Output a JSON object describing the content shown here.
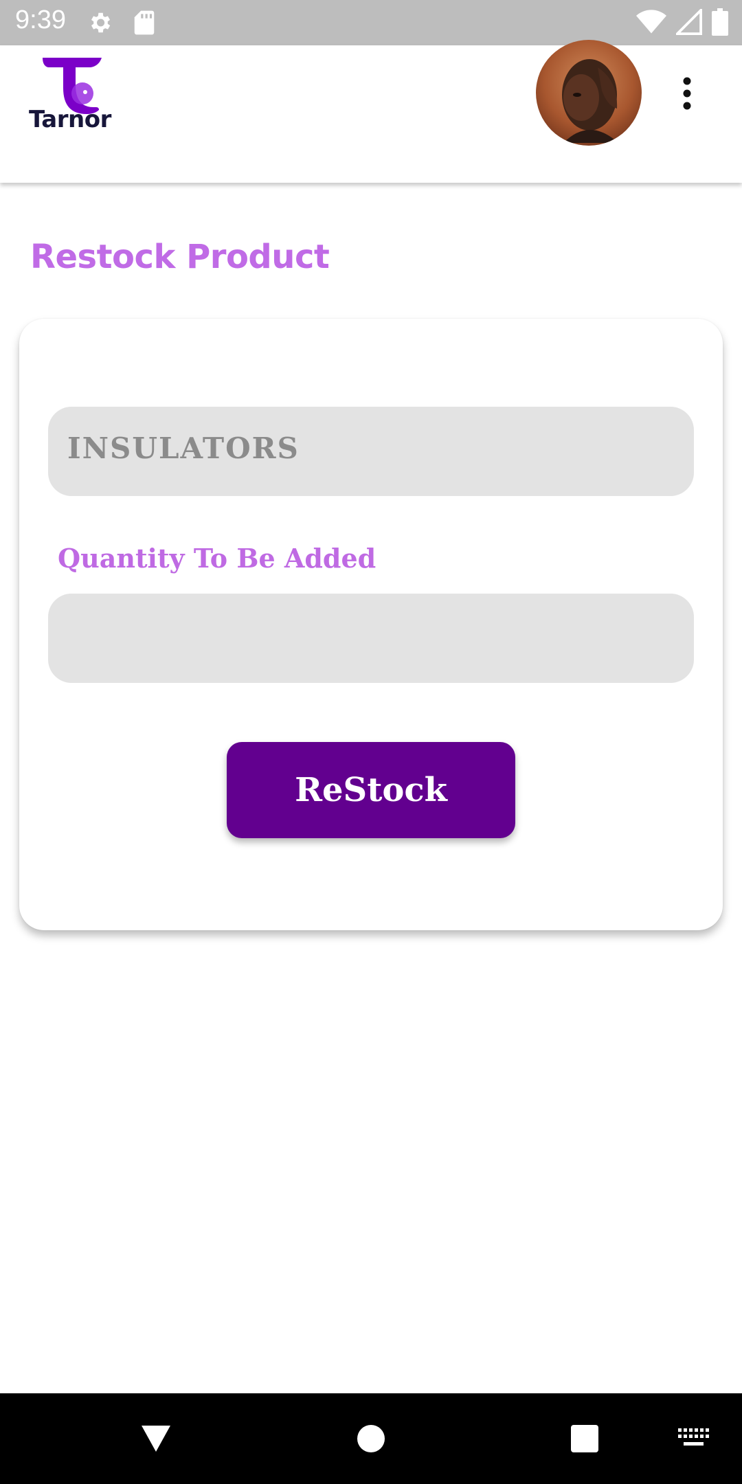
{
  "status_bar": {
    "time": "9:39",
    "icons": [
      "settings-icon",
      "sd-card-icon",
      "wifi-icon",
      "cell-signal-icon",
      "battery-icon"
    ]
  },
  "app_bar": {
    "logo_text": "Tarnor",
    "brand_color": "#7b00c8",
    "logo_text_color": "#17163a",
    "avatar": "user-profile-photo",
    "menu_icon": "more-vert-icon"
  },
  "page": {
    "title": "Restock Product",
    "title_color": "#c06be6"
  },
  "form": {
    "product_value": "INSULATORS",
    "quantity_label": "Quantity To Be Added",
    "quantity_value": "",
    "quantity_placeholder": "",
    "submit_label": "ReStock",
    "button_color": "#62008f",
    "field_color": "#e3e3e3"
  },
  "nav_bar": {
    "icons": [
      "back-icon",
      "home-icon",
      "recents-icon",
      "keyboard-icon"
    ]
  }
}
